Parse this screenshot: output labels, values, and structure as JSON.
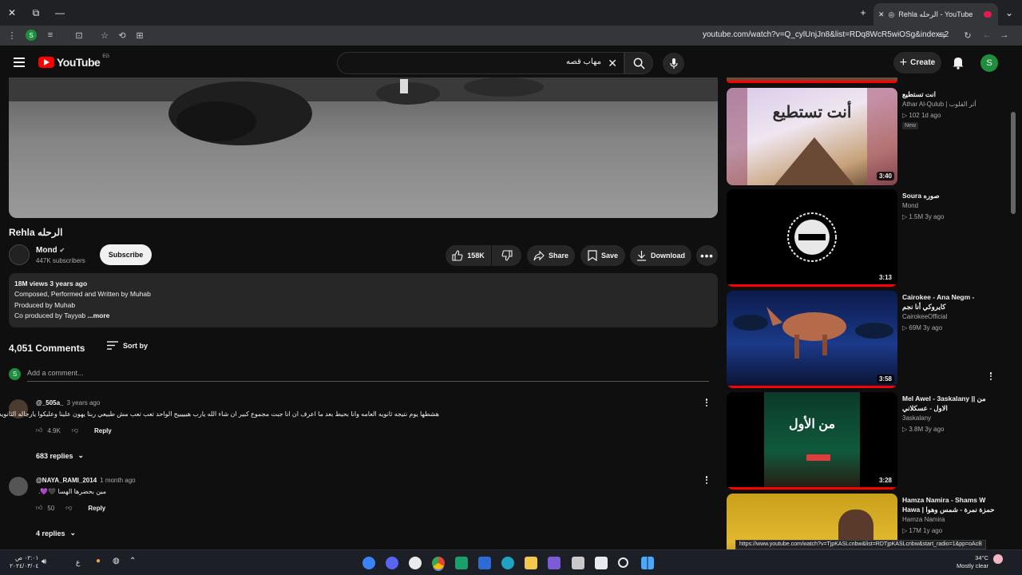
{
  "browser": {
    "tab_title": "Rehla الرحله - YouTube",
    "url": "youtube.com/watch?v=Q_cylUnjJn8&list=RDq8WcR5wiOSg&index=2",
    "status_url": "https://www.youtube.com/watch?v=TjpKASLcnbw&list=RDTjpKASLcnbw&start_radio=1&pp=oAcB"
  },
  "youtube": {
    "logo_text": "YouTube",
    "country_code": "EG",
    "search_value": "مهاب قصه",
    "create_label": "Create",
    "avatar_letter": "S"
  },
  "video": {
    "title": "Rehla الرحله",
    "channel": "Mond",
    "subscribers": "447K subscribers",
    "subscribe_label": "Subscribe",
    "likes": "158K",
    "share_label": "Share",
    "save_label": "Save",
    "download_label": "Download"
  },
  "description": {
    "stats": "18M views  3 years ago",
    "line1": "Composed, Performed and Written by Muhab",
    "line2": "Produced by Muhab",
    "line3": "Co produced by Tayyab",
    "more": "...more"
  },
  "comments": {
    "count": "4,051 Comments",
    "sort_label": "Sort by",
    "add_placeholder": "Add a comment...",
    "add_avatar": "S",
    "items": [
      {
        "author": "@_505a_",
        "time": "3 years ago",
        "text": "هشطها يوم نتيجه ثانويه العامه وانا بحيط بعد ما اعرف ان انا جبت مجموع كبير ان شاء الله يارب هيييييح الواحد تعب تعب مش طبيعي ربنا يهون علينا وعليكوا يارجاله الثانويه",
        "likes": "4.9K",
        "reply_label": "Reply",
        "replies": "683 replies"
      },
      {
        "author": "@NAYA_RAMI_2014",
        "time": "1 month ago",
        "text": "مين بحضرها الهسا 🖤💜.",
        "likes": "50",
        "reply_label": "Reply",
        "replies": "4 replies"
      }
    ]
  },
  "recommendations": [
    {
      "title": "انت تستطيع",
      "channel": "Athar Al-Qulub | أثر القلوب",
      "meta": "▷ 102  1d ago",
      "badge": "New",
      "duration": "3:40",
      "thumb_text": "أنت تستطيع"
    },
    {
      "title": "Soura صوره",
      "channel": "Mond",
      "meta": "▷ 1.5M  3y ago",
      "duration": "3:13"
    },
    {
      "title": "Cairokee - Ana Negm - كايروكي أنا نجم",
      "channel": "CairokeeOfficial",
      "meta": "▷ 69M  3y ago",
      "duration": "3:58"
    },
    {
      "title": "Mel Awel - 3askalany || من الاول - عسكلاني",
      "channel": "3askalany",
      "meta": "▷ 3.8M  3y ago",
      "duration": "3:28",
      "thumb_text": "من الأول"
    },
    {
      "title": "Hamza Namira - Shams W Hawa | حمزة نمرة - شمس وهوا",
      "channel": "Hamza Namira",
      "meta": "▷ 17M  1y ago"
    }
  ],
  "taskbar": {
    "time": "٠٢:٠١ ص",
    "date": "٢٠٢٤/٠٣/٠٤",
    "lang": "ع",
    "temp": "34°C",
    "weather": "Mostly clear"
  }
}
